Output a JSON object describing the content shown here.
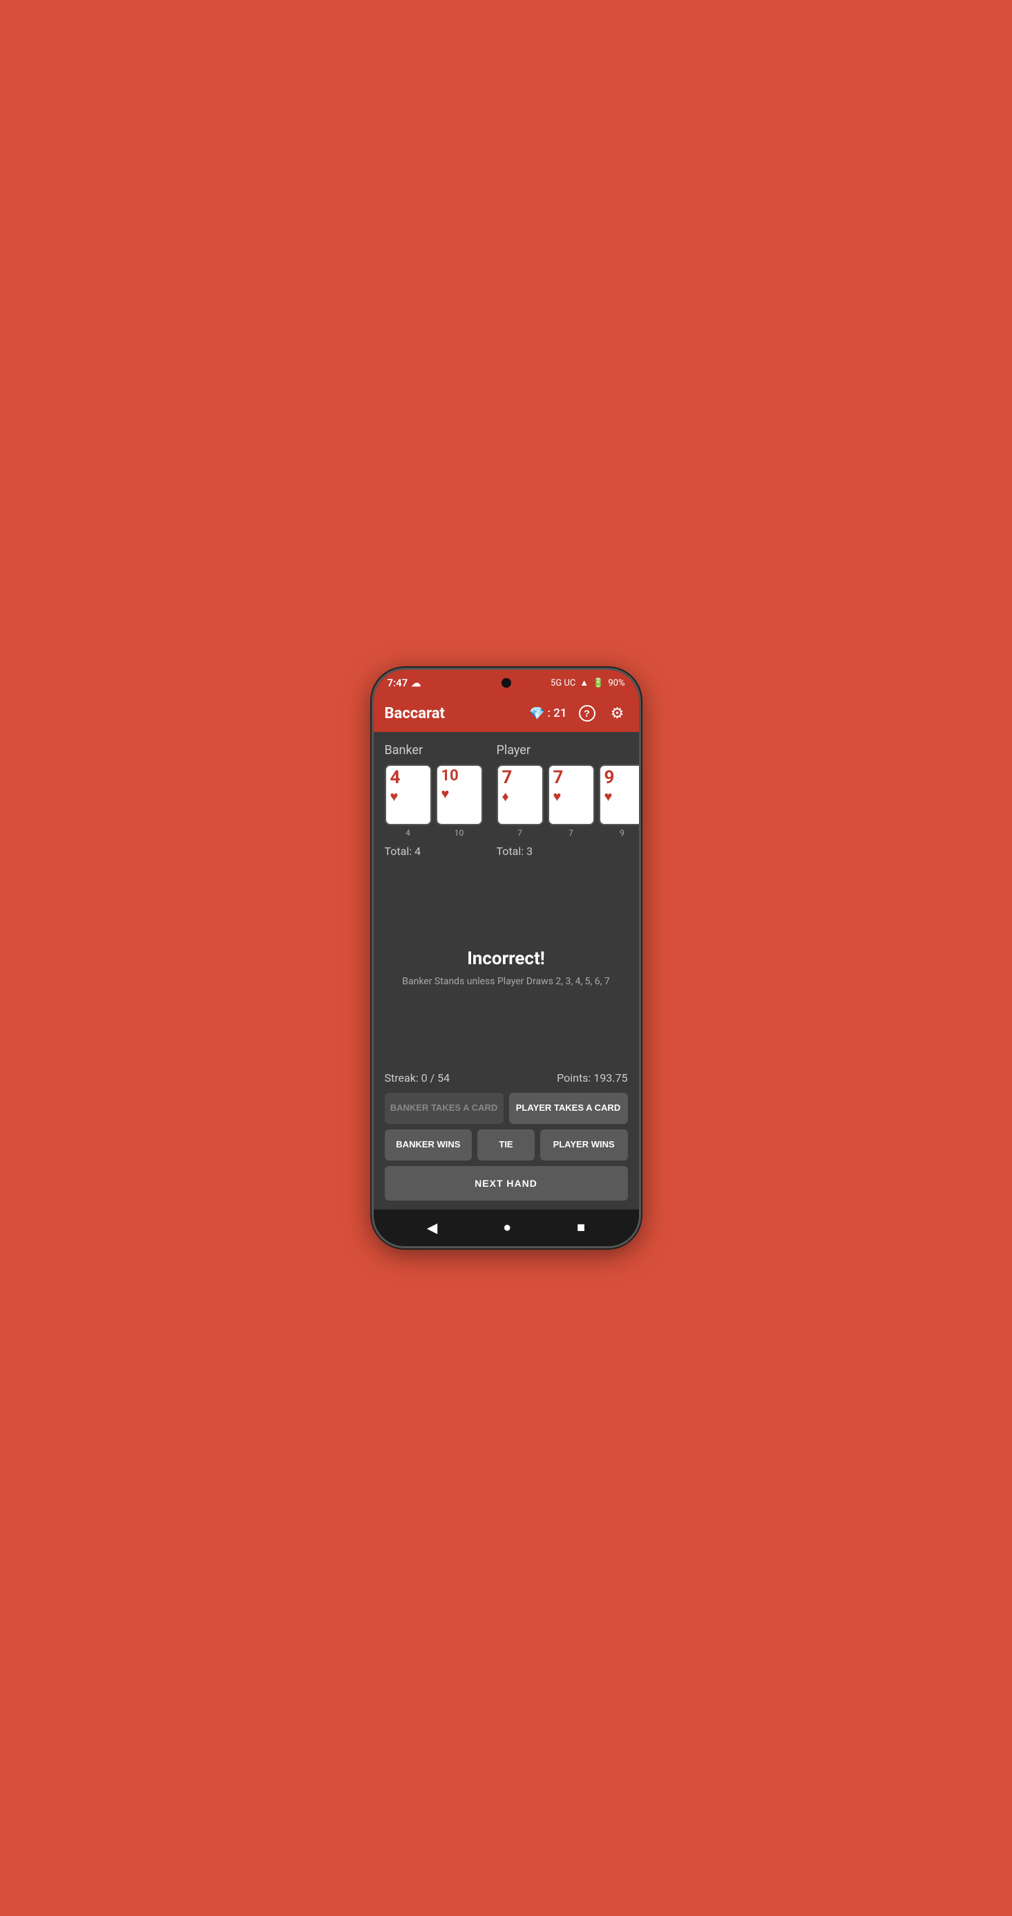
{
  "phone": {
    "status_bar": {
      "time": "7:47",
      "network": "5G UC",
      "signal_icon": "▲",
      "battery": "90%"
    },
    "app_bar": {
      "title": "Baccarat",
      "gem_label": ": 21",
      "help_icon": "?",
      "settings_icon": "⚙"
    },
    "banker": {
      "label": "Banker",
      "cards": [
        {
          "value": "4",
          "suit": "♥",
          "number": "4"
        },
        {
          "value": "10",
          "suit": "♥",
          "number": "10"
        }
      ],
      "total_label": "Total: 4"
    },
    "player": {
      "label": "Player",
      "cards": [
        {
          "value": "7",
          "suit": "♦",
          "number": "7"
        },
        {
          "value": "7",
          "suit": "♥",
          "number": "7"
        },
        {
          "value": "9",
          "suit": "♥",
          "number": "9"
        }
      ],
      "total_label": "Total: 3"
    },
    "result": {
      "title": "Incorrect!",
      "subtitle": "Banker Stands unless Player Draws 2, 3, 4, 5, 6, 7"
    },
    "stats": {
      "streak": "Streak: 0 / 54",
      "points": "Points: 193.75"
    },
    "buttons": {
      "banker_takes": "BANKER TAKES A CARD",
      "player_takes": "PLAYER TAKES A CARD",
      "banker_wins": "BANKER WINS",
      "tie": "TIE",
      "player_wins": "PLAYER WINS",
      "next_hand": "NEXT HAND"
    },
    "nav": {
      "back": "◀",
      "home": "●",
      "recent": "■"
    }
  }
}
